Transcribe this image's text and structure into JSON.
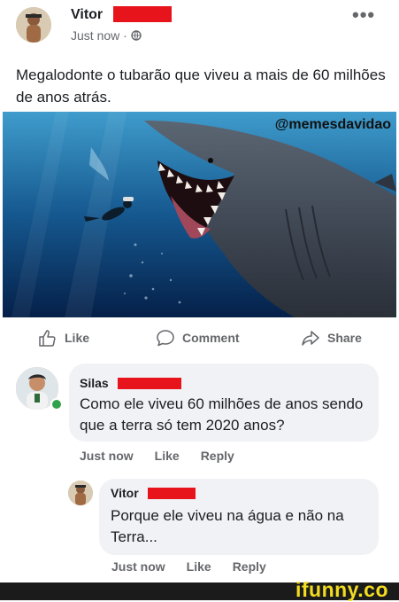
{
  "post": {
    "author": "Vitor",
    "timestamp": "Just now · ",
    "caption": "Megalodonte o tubarão que viveu a mais de 60 milhões de anos atrás.",
    "image_watermark": "@memesdavidao"
  },
  "actions": {
    "like": "Like",
    "comment": "Comment",
    "share": "Share"
  },
  "comments": [
    {
      "author": "Silas",
      "text": "Como ele viveu 60 milhões de anos sendo que a terra só tem 2020 anos?",
      "time": "Just now",
      "like": "Like",
      "reply": "Reply"
    },
    {
      "author": "Vitor",
      "text": "Porque ele viveu na água e não na Terra...",
      "time": "Just now",
      "like": "Like",
      "reply": "Reply"
    }
  ],
  "footer": {
    "brand": "ifunny.co"
  },
  "colors": {
    "redaction": "#e8141c",
    "online": "#31a24c",
    "brand": "#f2dc1f"
  },
  "icons": [
    "globe-icon",
    "more-options-icon",
    "like-icon",
    "comment-icon",
    "share-icon"
  ]
}
